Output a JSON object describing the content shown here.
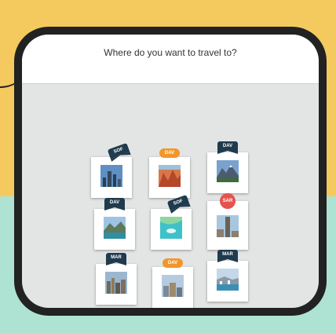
{
  "question": "Where do you want to travel to?",
  "colors": {
    "navy_tag": "#1f3b4d",
    "orange_tag": "#f2962b",
    "red_tag": "#e5534f",
    "background_yellow": "#f4c95e",
    "background_mint": "#aee3d4"
  },
  "cards": [
    {
      "tag": "SOF",
      "tag_style": "navy-tilted",
      "photo": "city-skyline-blue"
    },
    {
      "tag": "DAV",
      "tag_style": "orange",
      "photo": "red-canyon"
    },
    {
      "tag": "DAV",
      "tag_style": "navy",
      "photo": "snowy-mountains"
    },
    {
      "tag": "DAV",
      "tag_style": "navy",
      "photo": "lake-mountain"
    },
    {
      "tag": "SOF",
      "tag_style": "navy-tilted",
      "photo": "turquoise-water"
    },
    {
      "tag": "SAR",
      "tag_style": "red-circle",
      "photo": "tower-square"
    },
    {
      "tag": "MAR",
      "tag_style": "navy",
      "photo": "city-aerial"
    },
    {
      "tag": "DAV",
      "tag_style": "orange",
      "photo": "city-buildings"
    },
    {
      "tag": "MAR",
      "tag_style": "navy",
      "photo": "coastal-city"
    }
  ]
}
